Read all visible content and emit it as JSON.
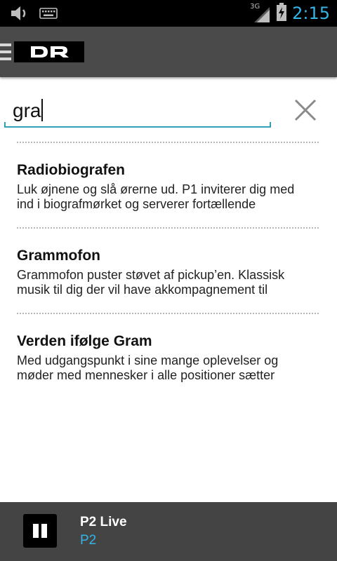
{
  "status_bar": {
    "network_label": "3G",
    "time": "2:15",
    "icons": [
      "volume-icon",
      "keyboard-icon",
      "signal-icon",
      "battery-charging-icon"
    ],
    "clock_color": "#33b5e5"
  },
  "action_bar": {
    "logo_text": "DR",
    "menu_icon": "hamburger-menu-icon"
  },
  "search": {
    "query": "gra",
    "clear_icon": "close-icon",
    "underline_color": "#33a0b8"
  },
  "results": [
    {
      "title": "Radiobiografen",
      "description_lines": [
        "Luk øjnene og slå ørerne ud. P1 inviterer dig med",
        "ind i biografmørket og serverer fortællende"
      ]
    },
    {
      "title": "Grammofon",
      "description_lines": [
        "Grammofon puster støvet af pickup’en. Klassisk",
        "musik til dig der vil have akkompagnement til"
      ]
    },
    {
      "title": "Verden ifølge Gram",
      "description_lines": [
        "Med udgangspunkt i sine mange oplevelser og",
        "møder med mennesker i alle positioner sætter"
      ]
    }
  ],
  "player": {
    "title": "P2 Live",
    "channel": "P2",
    "control_icon": "pause-icon",
    "accent_color": "#33b5e5"
  }
}
